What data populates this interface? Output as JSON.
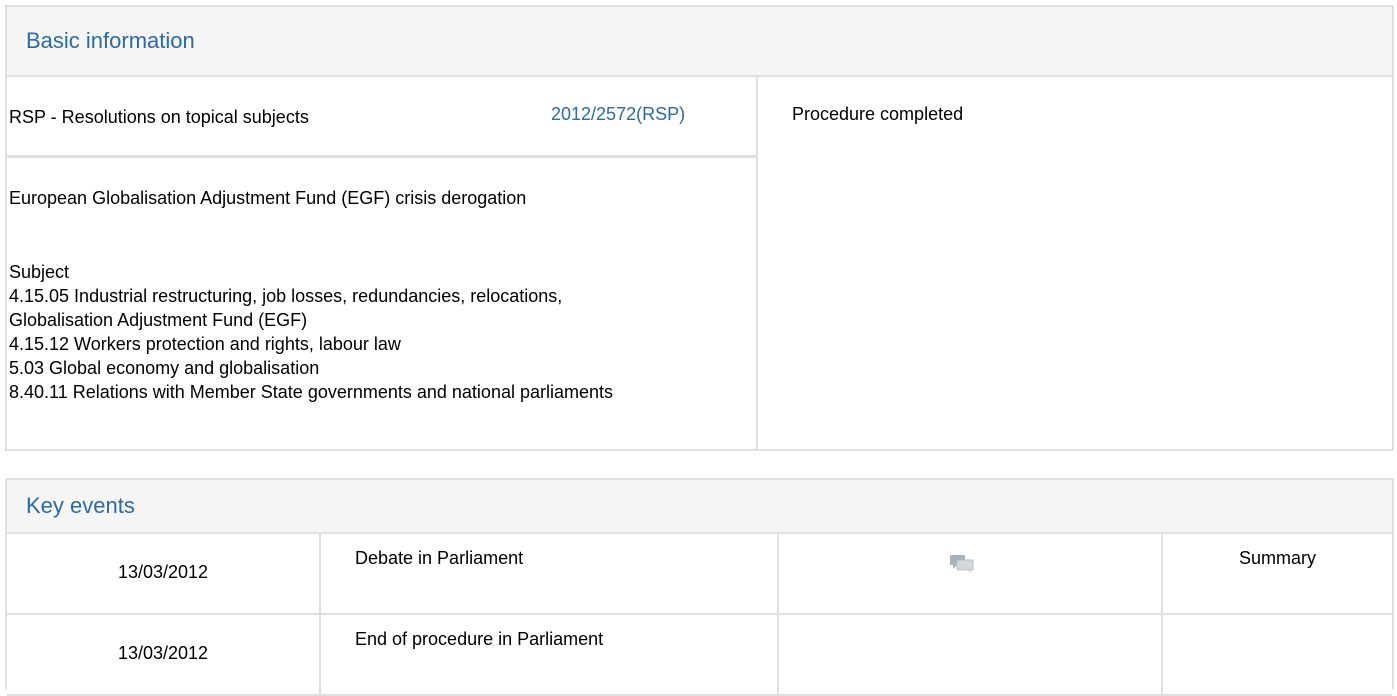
{
  "basic": {
    "heading": "Basic information",
    "procedure_type": "RSP - Resolutions on topical subjects",
    "procedure_ref": "2012/2572(RSP)",
    "status": "Procedure completed",
    "title": "European Globalisation Adjustment Fund (EGF) crisis derogation",
    "subject_heading": "Subject",
    "subjects": [
      "4.15.05 Industrial restructuring, job losses, redundancies, relocations,",
      "Globalisation Adjustment Fund (EGF)",
      "4.15.12 Workers protection and rights, labour law",
      "5.03 Global economy and globalisation",
      "8.40.11 Relations with Member State governments and national parliaments"
    ]
  },
  "events": {
    "heading": "Key events",
    "rows": [
      {
        "date": "13/03/2012",
        "event": "Debate in Parliament",
        "icon": "debate-chat-icon",
        "summary": "Summary"
      },
      {
        "date": "13/03/2012",
        "event": "End of procedure in Parliament",
        "icon": "",
        "summary": ""
      }
    ]
  }
}
